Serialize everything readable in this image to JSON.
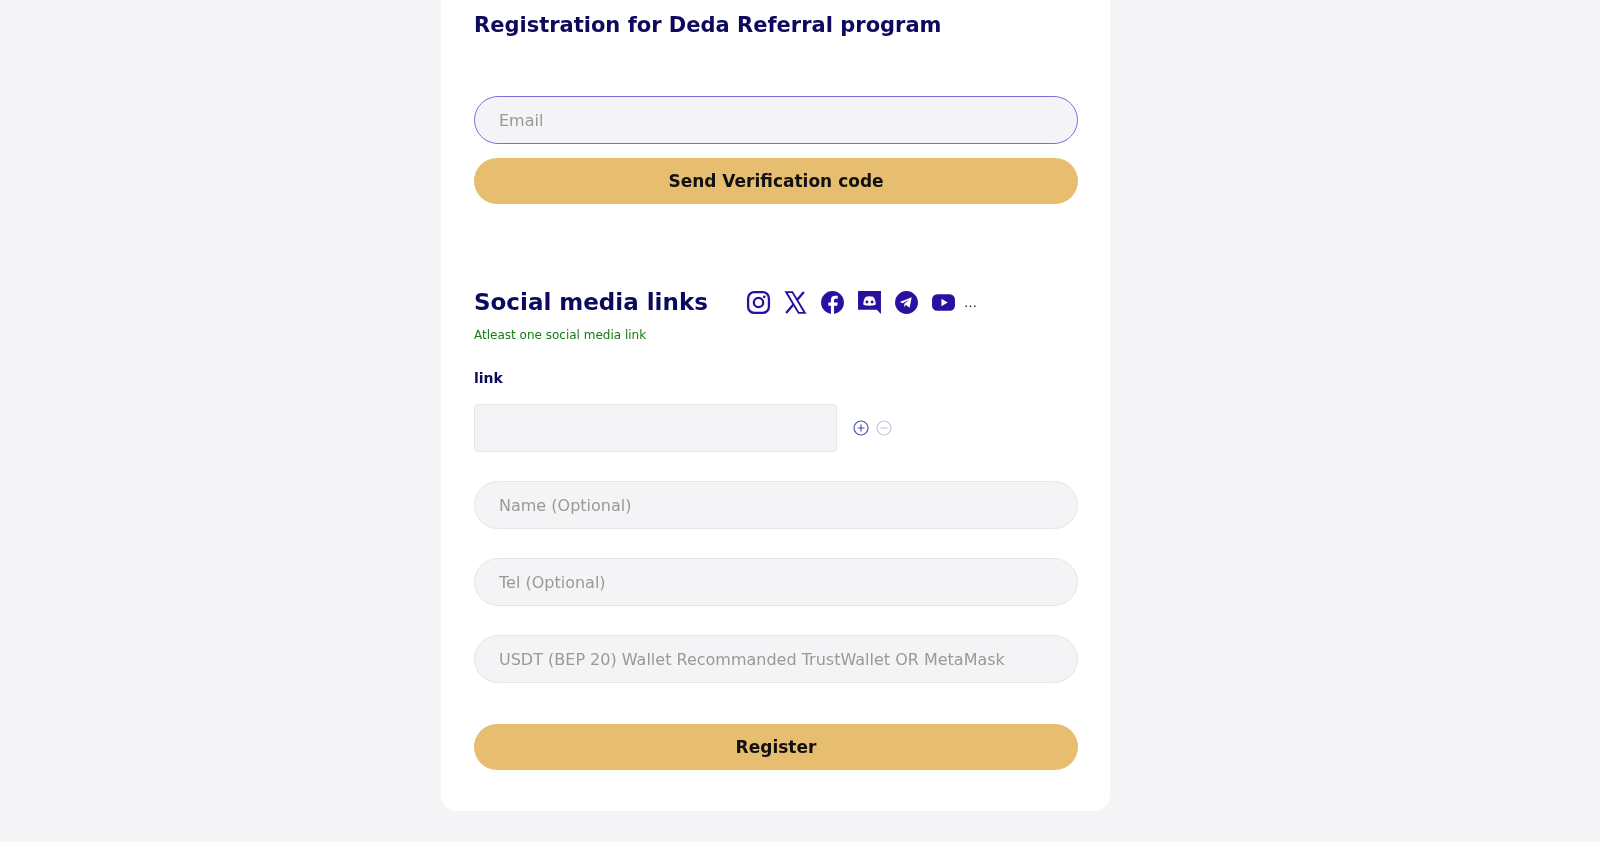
{
  "title": "Registration for Deda Referral program",
  "email": {
    "placeholder": "Email",
    "focused": true
  },
  "send_button": "Send Verification code",
  "social": {
    "heading": "Social media links",
    "more": "…",
    "note": "Atleast one social media link"
  },
  "link": {
    "label": "link",
    "add_disabled": false,
    "remove_disabled": true
  },
  "fields": [
    {
      "placeholder": "Name (Optional)"
    },
    {
      "placeholder": "Tel (Optional)"
    },
    {
      "placeholder": "USDT (BEP 20) Wallet Recommanded TrustWallet OR MetaMask"
    }
  ],
  "register_button": "Register"
}
